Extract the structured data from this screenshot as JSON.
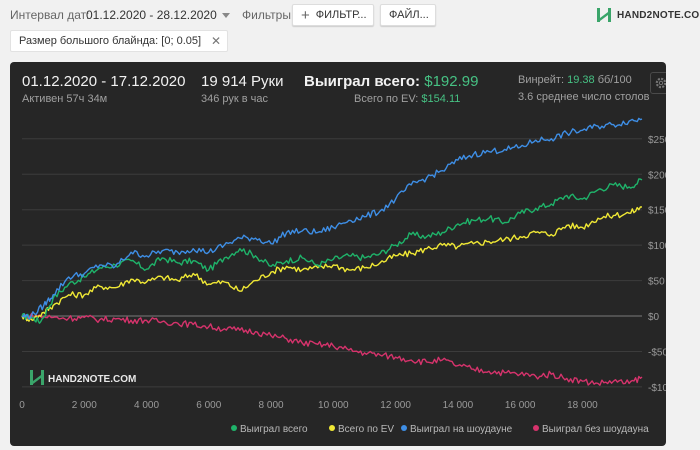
{
  "toolbar": {
    "date_label": "Интервал дат:",
    "date_range": "01.12.2020 - 28.12.2020",
    "filters_label": "Фильтры:",
    "filters_button": "ФИЛЬТР...",
    "files_button": "ФАЙЛ...",
    "logo_text": "HAND2NOTE.COM"
  },
  "filter_chip": {
    "label": "Размер большого блайнда: [0; 0.05]"
  },
  "summary": {
    "period": "01.12.2020 - 17.12.2020",
    "active": "Активен 57ч 34м",
    "hands": "19 914 Руки",
    "hands_per_hour": "346 рук в час",
    "won_total_label": "Выиграл всего:",
    "won_total_value": "$192.99",
    "ev_label": "Всего по EV:",
    "ev_value": "$154.11",
    "winrate_label": "Винрейт:",
    "winrate_value": "19.38",
    "winrate_unit": "бб/100",
    "tables": "3.6 среднее число столов"
  },
  "watermark": "HAND2NOTE.COM",
  "colors": {
    "won_total": "#1fb36a",
    "ev": "#f0e835",
    "showdown": "#3e8ee5",
    "non_showdown": "#d6336c",
    "accent_green": "#46c183"
  },
  "chart_data": {
    "type": "line",
    "x_tick_labels": [
      "0",
      "2 000",
      "4 000",
      "6 000",
      "8 000",
      "10 000",
      "12 000",
      "14 000",
      "16 000",
      "18 000"
    ],
    "x_ticks": [
      0,
      2000,
      4000,
      6000,
      8000,
      10000,
      12000,
      14000,
      16000,
      18000
    ],
    "y_tick_labels": [
      "$250",
      "$200",
      "$150",
      "$100",
      "$50",
      "$0",
      "-$50",
      "-$100"
    ],
    "y_ticks": [
      250,
      200,
      150,
      100,
      50,
      0,
      -50,
      -100
    ],
    "xlim": [
      0,
      19914
    ],
    "ylim": [
      -110,
      285
    ],
    "grid": true,
    "legend_position": "bottom-right",
    "series": [
      {
        "name": "Выиграл всего",
        "color": "#1fb36a",
        "points": [
          [
            0,
            0
          ],
          [
            300,
            -2
          ],
          [
            600,
            -8
          ],
          [
            1000,
            25
          ],
          [
            1500,
            45
          ],
          [
            2000,
            55
          ],
          [
            2500,
            68
          ],
          [
            3000,
            72
          ],
          [
            3500,
            78
          ],
          [
            4000,
            66
          ],
          [
            4500,
            82
          ],
          [
            5000,
            75
          ],
          [
            5500,
            78
          ],
          [
            6000,
            65
          ],
          [
            6500,
            82
          ],
          [
            7000,
            95
          ],
          [
            7500,
            85
          ],
          [
            8000,
            70
          ],
          [
            8500,
            78
          ],
          [
            9000,
            82
          ],
          [
            9500,
            72
          ],
          [
            10000,
            80
          ],
          [
            10500,
            85
          ],
          [
            11000,
            82
          ],
          [
            11500,
            88
          ],
          [
            12000,
            100
          ],
          [
            12500,
            115
          ],
          [
            13000,
            112
          ],
          [
            13500,
            118
          ],
          [
            14000,
            130
          ],
          [
            14500,
            135
          ],
          [
            15000,
            138
          ],
          [
            15500,
            132
          ],
          [
            16000,
            145
          ],
          [
            16500,
            152
          ],
          [
            17000,
            158
          ],
          [
            17500,
            170
          ],
          [
            18000,
            165
          ],
          [
            18500,
            178
          ],
          [
            19000,
            185
          ],
          [
            19500,
            182
          ],
          [
            19914,
            192
          ]
        ]
      },
      {
        "name": "Всего по EV",
        "color": "#f0e835",
        "points": [
          [
            0,
            0
          ],
          [
            300,
            -5
          ],
          [
            700,
            5
          ],
          [
            1000,
            15
          ],
          [
            1500,
            30
          ],
          [
            2000,
            30
          ],
          [
            2500,
            42
          ],
          [
            3000,
            40
          ],
          [
            3500,
            52
          ],
          [
            4000,
            48
          ],
          [
            4500,
            55
          ],
          [
            5000,
            50
          ],
          [
            5500,
            60
          ],
          [
            6000,
            45
          ],
          [
            6500,
            48
          ],
          [
            7000,
            35
          ],
          [
            7500,
            50
          ],
          [
            8000,
            62
          ],
          [
            8500,
            70
          ],
          [
            9000,
            65
          ],
          [
            9500,
            68
          ],
          [
            10000,
            72
          ],
          [
            10500,
            65
          ],
          [
            11000,
            68
          ],
          [
            11500,
            75
          ],
          [
            12000,
            85
          ],
          [
            12500,
            88
          ],
          [
            13000,
            95
          ],
          [
            13500,
            100
          ],
          [
            14000,
            98
          ],
          [
            14500,
            102
          ],
          [
            15000,
            105
          ],
          [
            15500,
            108
          ],
          [
            16000,
            112
          ],
          [
            16500,
            118
          ],
          [
            17000,
            115
          ],
          [
            17500,
            128
          ],
          [
            18000,
            125
          ],
          [
            18500,
            138
          ],
          [
            19000,
            142
          ],
          [
            19500,
            145
          ],
          [
            19914,
            154
          ]
        ]
      },
      {
        "name": "Выиграл на шоудауне",
        "color": "#3e8ee5",
        "points": [
          [
            0,
            0
          ],
          [
            300,
            0
          ],
          [
            700,
            15
          ],
          [
            1000,
            30
          ],
          [
            1500,
            55
          ],
          [
            2000,
            60
          ],
          [
            2500,
            72
          ],
          [
            3000,
            70
          ],
          [
            3500,
            90
          ],
          [
            4000,
            85
          ],
          [
            4500,
            92
          ],
          [
            5000,
            90
          ],
          [
            5500,
            95
          ],
          [
            6000,
            90
          ],
          [
            6500,
            100
          ],
          [
            7000,
            110
          ],
          [
            7500,
            110
          ],
          [
            8000,
            102
          ],
          [
            8500,
            118
          ],
          [
            9000,
            120
          ],
          [
            9500,
            118
          ],
          [
            10000,
            125
          ],
          [
            10500,
            135
          ],
          [
            11000,
            140
          ],
          [
            11500,
            148
          ],
          [
            12000,
            165
          ],
          [
            12500,
            185
          ],
          [
            13000,
            195
          ],
          [
            13500,
            205
          ],
          [
            14000,
            220
          ],
          [
            14500,
            228
          ],
          [
            15000,
            232
          ],
          [
            15500,
            235
          ],
          [
            16000,
            238
          ],
          [
            16500,
            248
          ],
          [
            17000,
            250
          ],
          [
            17500,
            258
          ],
          [
            18000,
            262
          ],
          [
            18500,
            268
          ],
          [
            19000,
            270
          ],
          [
            19500,
            275
          ],
          [
            19914,
            278
          ]
        ]
      },
      {
        "name": "Выиграл без шоудауна",
        "color": "#d6336c",
        "points": [
          [
            0,
            0
          ],
          [
            500,
            0
          ],
          [
            1000,
            -2
          ],
          [
            1500,
            -3
          ],
          [
            2000,
            -2
          ],
          [
            2500,
            -5
          ],
          [
            3000,
            -4
          ],
          [
            3500,
            -6
          ],
          [
            4000,
            -6
          ],
          [
            4500,
            -8
          ],
          [
            5000,
            -10
          ],
          [
            5500,
            -12
          ],
          [
            6000,
            -15
          ],
          [
            6500,
            -18
          ],
          [
            7000,
            -20
          ],
          [
            7500,
            -22
          ],
          [
            8000,
            -28
          ],
          [
            8500,
            -32
          ],
          [
            9000,
            -38
          ],
          [
            9500,
            -40
          ],
          [
            10000,
            -42
          ],
          [
            10500,
            -48
          ],
          [
            11000,
            -52
          ],
          [
            11500,
            -55
          ],
          [
            12000,
            -58
          ],
          [
            12500,
            -62
          ],
          [
            13000,
            -65
          ],
          [
            13500,
            -62
          ],
          [
            14000,
            -70
          ],
          [
            14500,
            -75
          ],
          [
            15000,
            -78
          ],
          [
            15500,
            -80
          ],
          [
            16000,
            -82
          ],
          [
            16500,
            -85
          ],
          [
            17000,
            -82
          ],
          [
            17500,
            -88
          ],
          [
            18000,
            -92
          ],
          [
            18500,
            -95
          ],
          [
            19000,
            -92
          ],
          [
            19500,
            -95
          ],
          [
            19914,
            -86
          ]
        ]
      }
    ]
  }
}
